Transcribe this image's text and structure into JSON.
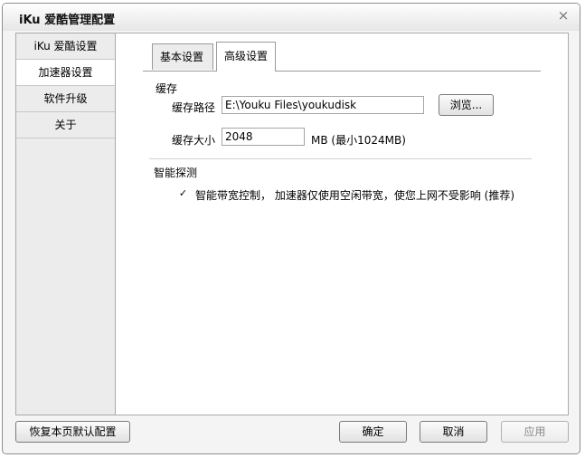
{
  "window": {
    "title": "iKu 爱酷管理配置",
    "close_glyph": "×"
  },
  "sidebar": {
    "items": [
      {
        "label": "iKu 爱酷设置"
      },
      {
        "label": "加速器设置"
      },
      {
        "label": "软件升级"
      },
      {
        "label": "关于"
      }
    ],
    "active_index": 1
  },
  "tabs": [
    {
      "label": "基本设置"
    },
    {
      "label": "高级设置"
    }
  ],
  "active_tab": 1,
  "cache": {
    "section_title": "缓存",
    "path_label": "缓存路径",
    "path_value": "E:\\Youku Files\\youkudisk",
    "browse_label": "浏览...",
    "size_label": "缓存大小",
    "size_value": "2048",
    "size_hint": "MB (最小1024MB)"
  },
  "smart": {
    "section_title": "智能探测",
    "checkbox_label": "智能带宽控制， 加速器仅使用空闲带宽，使您上网不受影响 (推荐)",
    "checked": true,
    "check_glyph": "✓"
  },
  "footer": {
    "restore_label": "恢复本页默认配置",
    "ok_label": "确定",
    "cancel_label": "取消",
    "apply_label": "应用"
  }
}
